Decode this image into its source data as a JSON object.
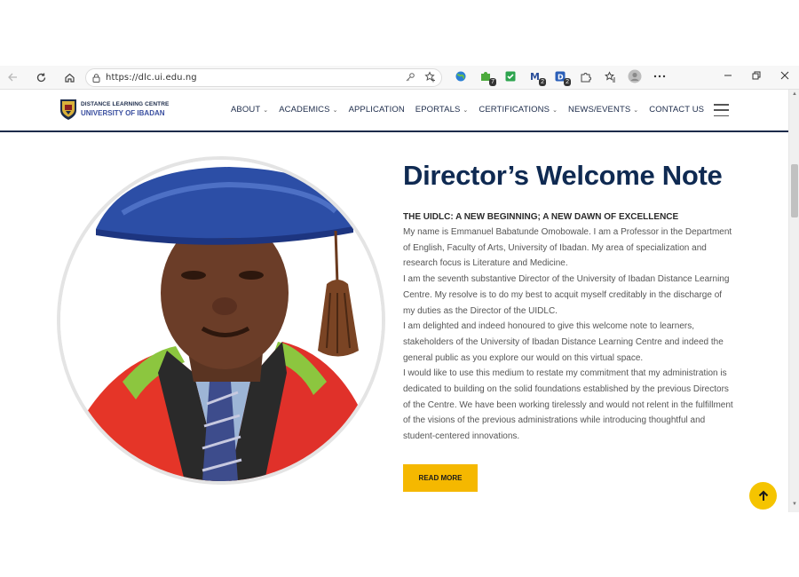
{
  "browser": {
    "url": "https://dlc.ui.edu.ng",
    "extensions": [
      {
        "name": "ext-globe",
        "badge": ""
      },
      {
        "name": "ext-puzzle-green",
        "badge": "7"
      },
      {
        "name": "ext-check",
        "badge": ""
      },
      {
        "name": "ext-m",
        "badge": "2"
      },
      {
        "name": "ext-d",
        "badge": "2"
      }
    ]
  },
  "site": {
    "logo_line1": "DISTANCE LEARNING CENTRE",
    "logo_line2": "UNIVERSITY OF IBADAN",
    "nav": [
      {
        "label": "ABOUT",
        "dropdown": true
      },
      {
        "label": "ACADEMICS",
        "dropdown": true
      },
      {
        "label": "APPLICATION",
        "dropdown": false
      },
      {
        "label": "EPORTALS",
        "dropdown": true
      },
      {
        "label": "CERTIFICATIONS",
        "dropdown": true
      },
      {
        "label": "NEWS/EVENTS",
        "dropdown": true
      },
      {
        "label": "CONTACT US",
        "dropdown": false
      }
    ]
  },
  "content": {
    "title": "Director’s Welcome Note",
    "subheading": "THE UIDLC: A NEW BEGINNING; A NEW DAWN OF EXCELLENCE",
    "paragraphs": [
      "My name is Emmanuel Babatunde Omobowale. I am a Professor in the Department of English, Faculty of Arts, University of Ibadan. My area of specialization and research focus is Literature and Medicine.",
      "I am the seventh substantive Director of the University of Ibadan Distance Learning Centre. My resolve is to do my best to acquit myself creditably in the discharge of my duties as the Director of the UIDLC.",
      "I am delighted and indeed honoured to give this welcome note to learners, stakeholders of the University of Ibadan Distance Learning Centre and indeed the general public as you explore our would on this virtual space.",
      "I would like to use this medium to restate my commitment that my administration is dedicated to building on the solid foundations established by the previous Directors of the Centre. We have been working tirelessly and would not relent in the fulfillment of the visions of the previous administrations while introducing thoughtful and student-centered innovations."
    ],
    "read_more_label": "READ MORE"
  },
  "colors": {
    "brand_navy": "#0f2a52",
    "accent_yellow": "#f5b800"
  }
}
